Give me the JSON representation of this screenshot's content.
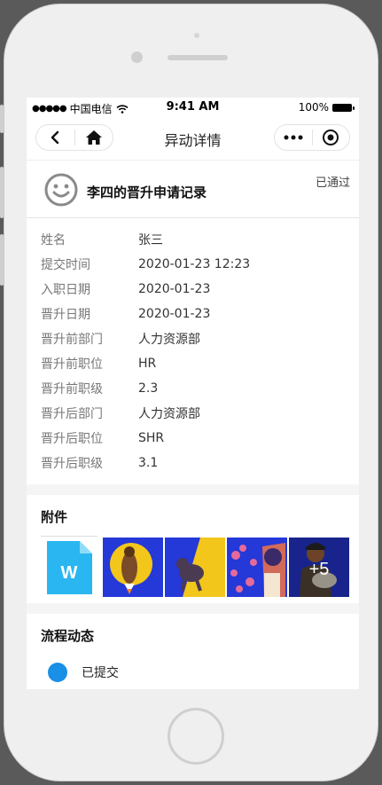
{
  "status_bar": {
    "carrier": "中国电信",
    "time": "9:41 AM",
    "battery": "100%"
  },
  "navbar": {
    "title": "异动详情"
  },
  "record": {
    "title": "李四的晋升申请记录",
    "status": "已通过"
  },
  "details": [
    {
      "label": "姓名",
      "value": "张三"
    },
    {
      "label": "提交时间",
      "value": "2020-01-23 12:23"
    },
    {
      "label": "入职日期",
      "value": "2020-01-23"
    },
    {
      "label": "晋升日期",
      "value": "2020-01-23"
    },
    {
      "label": "晋升前部门",
      "value": "人力资源部"
    },
    {
      "label": "晋升前职位",
      "value": "HR"
    },
    {
      "label": "晋升前职级",
      "value": "2.3"
    },
    {
      "label": "晋升后部门",
      "value": "人力资源部"
    },
    {
      "label": "晋升后职位",
      "value": "SHR"
    },
    {
      "label": "晋升后职级",
      "value": "3.1"
    }
  ],
  "attachments": {
    "title": "附件",
    "file_icon_letter": "W",
    "more_count": "+5"
  },
  "flow": {
    "title": "流程动态",
    "items": [
      {
        "label": "已提交"
      }
    ]
  },
  "colors": {
    "accent": "#1a8fe6",
    "file_blue": "#2ab6f0",
    "image_blue": "#2538d8",
    "image_yellow": "#f3c61c"
  }
}
